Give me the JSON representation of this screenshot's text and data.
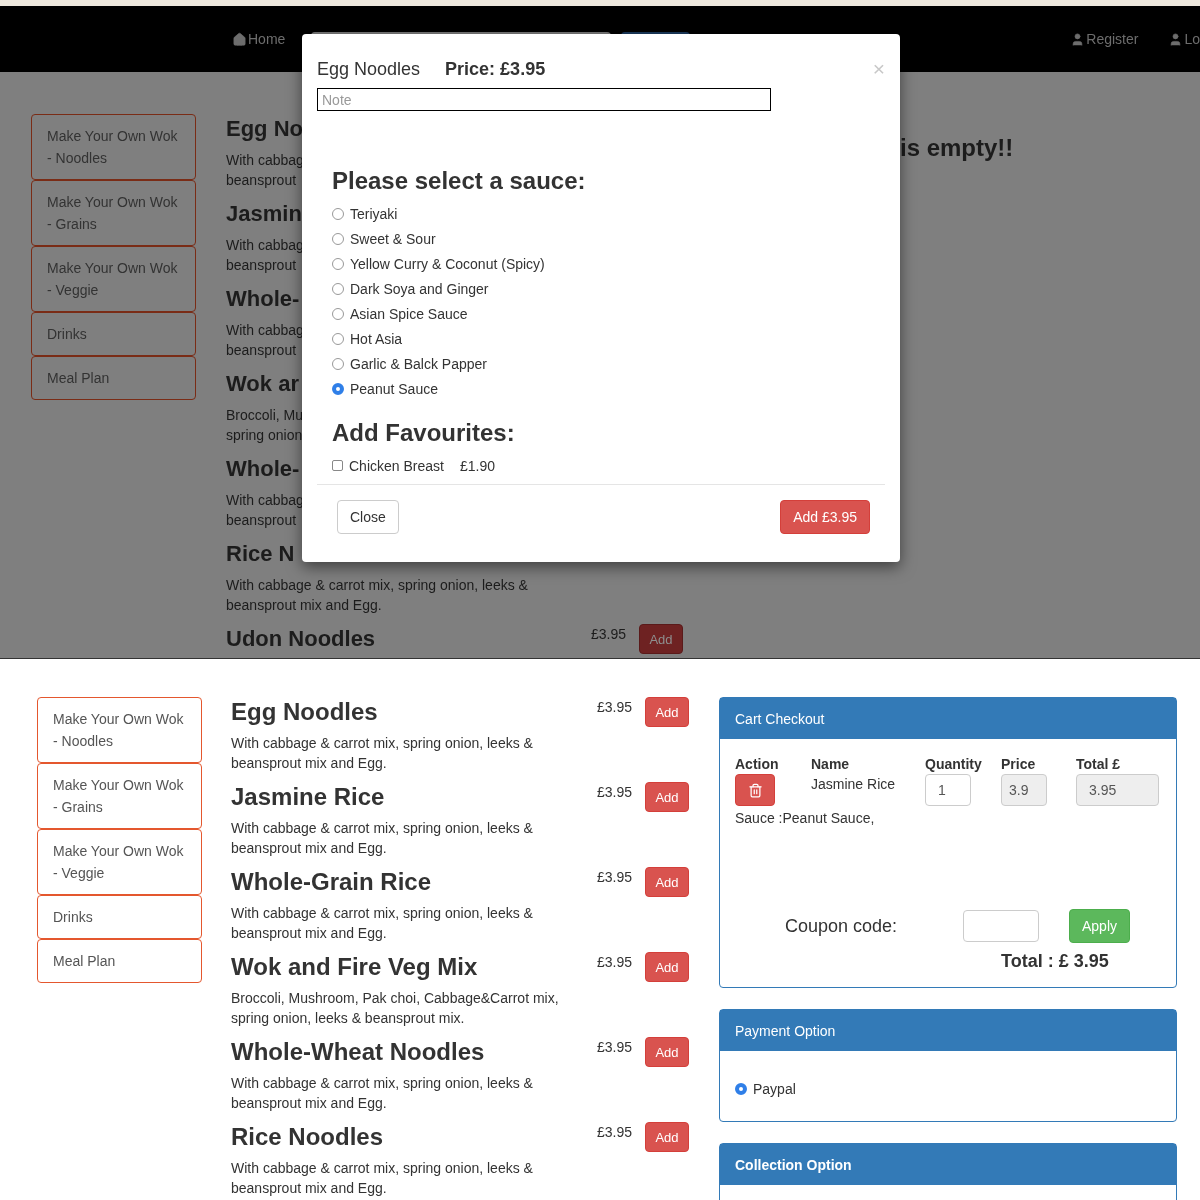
{
  "top_screen": {
    "navbar": {
      "home": "Home",
      "right_links": [
        "Register",
        "Lo"
      ]
    },
    "sidebar": [
      "Make Your Own Wok - Noodles",
      "Make Your Own Wok - Grains",
      "Make Your Own Wok - Veggie",
      "Drinks",
      "Meal Plan"
    ],
    "menu": [
      {
        "title": "Egg No",
        "description": [
          "With cabbag",
          "beansprout"
        ]
      },
      {
        "title": "Jasmin",
        "description": [
          "With cabbag",
          "beansprout"
        ]
      },
      {
        "title": "Whole-",
        "description": [
          "With cabbag",
          "beansprout"
        ]
      },
      {
        "title": "Wok ar",
        "description": [
          "Broccoli, Mu",
          "spring onion"
        ]
      },
      {
        "title": "Whole-",
        "description": [
          "With cabbag",
          "beansprout"
        ]
      },
      {
        "title": "Rice N",
        "description": [
          "With cabbage & carrot mix, spring onion, leeks &",
          "beansprout mix and Egg."
        ]
      },
      {
        "title": "Udon Noodles",
        "price": "£3.95",
        "button": "Add"
      }
    ],
    "cart_message": "is empty!!",
    "modal": {
      "title": "Egg Noodles",
      "price": "Price: £3.95",
      "close": "×",
      "note": {
        "placeholder": "Note"
      },
      "sauce_heading": "Please select a sauce:",
      "sauces": [
        {
          "label": "Teriyaki",
          "selected": false
        },
        {
          "label": "Sweet & Sour",
          "selected": false
        },
        {
          "label": "Yellow Curry & Coconut (Spicy)",
          "selected": false
        },
        {
          "label": "Dark Soya and Ginger",
          "selected": false
        },
        {
          "label": "Asian Spice Sauce",
          "selected": false
        },
        {
          "label": "Hot Asia",
          "selected": false
        },
        {
          "label": "Garlic & Balck Papper",
          "selected": false
        },
        {
          "label": "Peanut Sauce",
          "selected": true
        }
      ],
      "favourites_heading": "Add Favourites:",
      "favourites": [
        {
          "label": "Chicken Breast",
          "price": "£1.90",
          "checked": false
        }
      ],
      "close_button": "Close",
      "add_button": "Add £3.95"
    }
  },
  "bottom_screen": {
    "sidebar": [
      "Make Your Own Wok - Noodles",
      "Make Your Own Wok - Grains",
      "Make Your Own Wok - Veggie",
      "Drinks",
      "Meal Plan"
    ],
    "menu": [
      {
        "title": "Egg Noodles",
        "price": "£3.95",
        "button": "Add",
        "description": [
          "With cabbage & carrot mix, spring onion, leeks &",
          "beansprout mix and Egg."
        ]
      },
      {
        "title": "Jasmine Rice",
        "price": "£3.95",
        "button": "Add",
        "description": [
          "With cabbage & carrot mix, spring onion, leeks &",
          "beansprout mix and Egg."
        ]
      },
      {
        "title": "Whole-Grain Rice",
        "price": "£3.95",
        "button": "Add",
        "description": [
          "With cabbage & carrot mix, spring onion, leeks &",
          "beansprout mix and Egg."
        ]
      },
      {
        "title": "Wok and Fire Veg Mix",
        "price": "£3.95",
        "button": "Add",
        "description": [
          "Broccoli, Mushroom, Pak choi, Cabbage&Carrot mix,",
          "spring onion, leeks & beansprout mix."
        ]
      },
      {
        "title": "Whole-Wheat Noodles",
        "price": "£3.95",
        "button": "Add",
        "description": [
          "With cabbage & carrot mix, spring onion, leeks &",
          "beansprout mix and Egg."
        ]
      },
      {
        "title": "Rice Noodles",
        "price": "£3.95",
        "button": "Add",
        "description": [
          "With cabbage & carrot mix, spring onion, leeks &",
          "beansprout mix and Egg."
        ]
      }
    ],
    "cart": {
      "title": "Cart Checkout",
      "columns": [
        "Action",
        "Name",
        "Quantity",
        "Price",
        "Total £"
      ],
      "rows": [
        {
          "name": "Jasmine Rice",
          "quantity": "1",
          "price": "3.9",
          "total": "3.95",
          "note": "Sauce :Peanut Sauce,"
        }
      ],
      "coupon_label": "Coupon code:",
      "apply_button": "Apply",
      "total": "Total : £ 3.95"
    },
    "payment": {
      "title": "Payment Option",
      "options": [
        {
          "label": "Paypal",
          "selected": true
        }
      ]
    },
    "collection": {
      "title": "Collection Option"
    }
  }
}
